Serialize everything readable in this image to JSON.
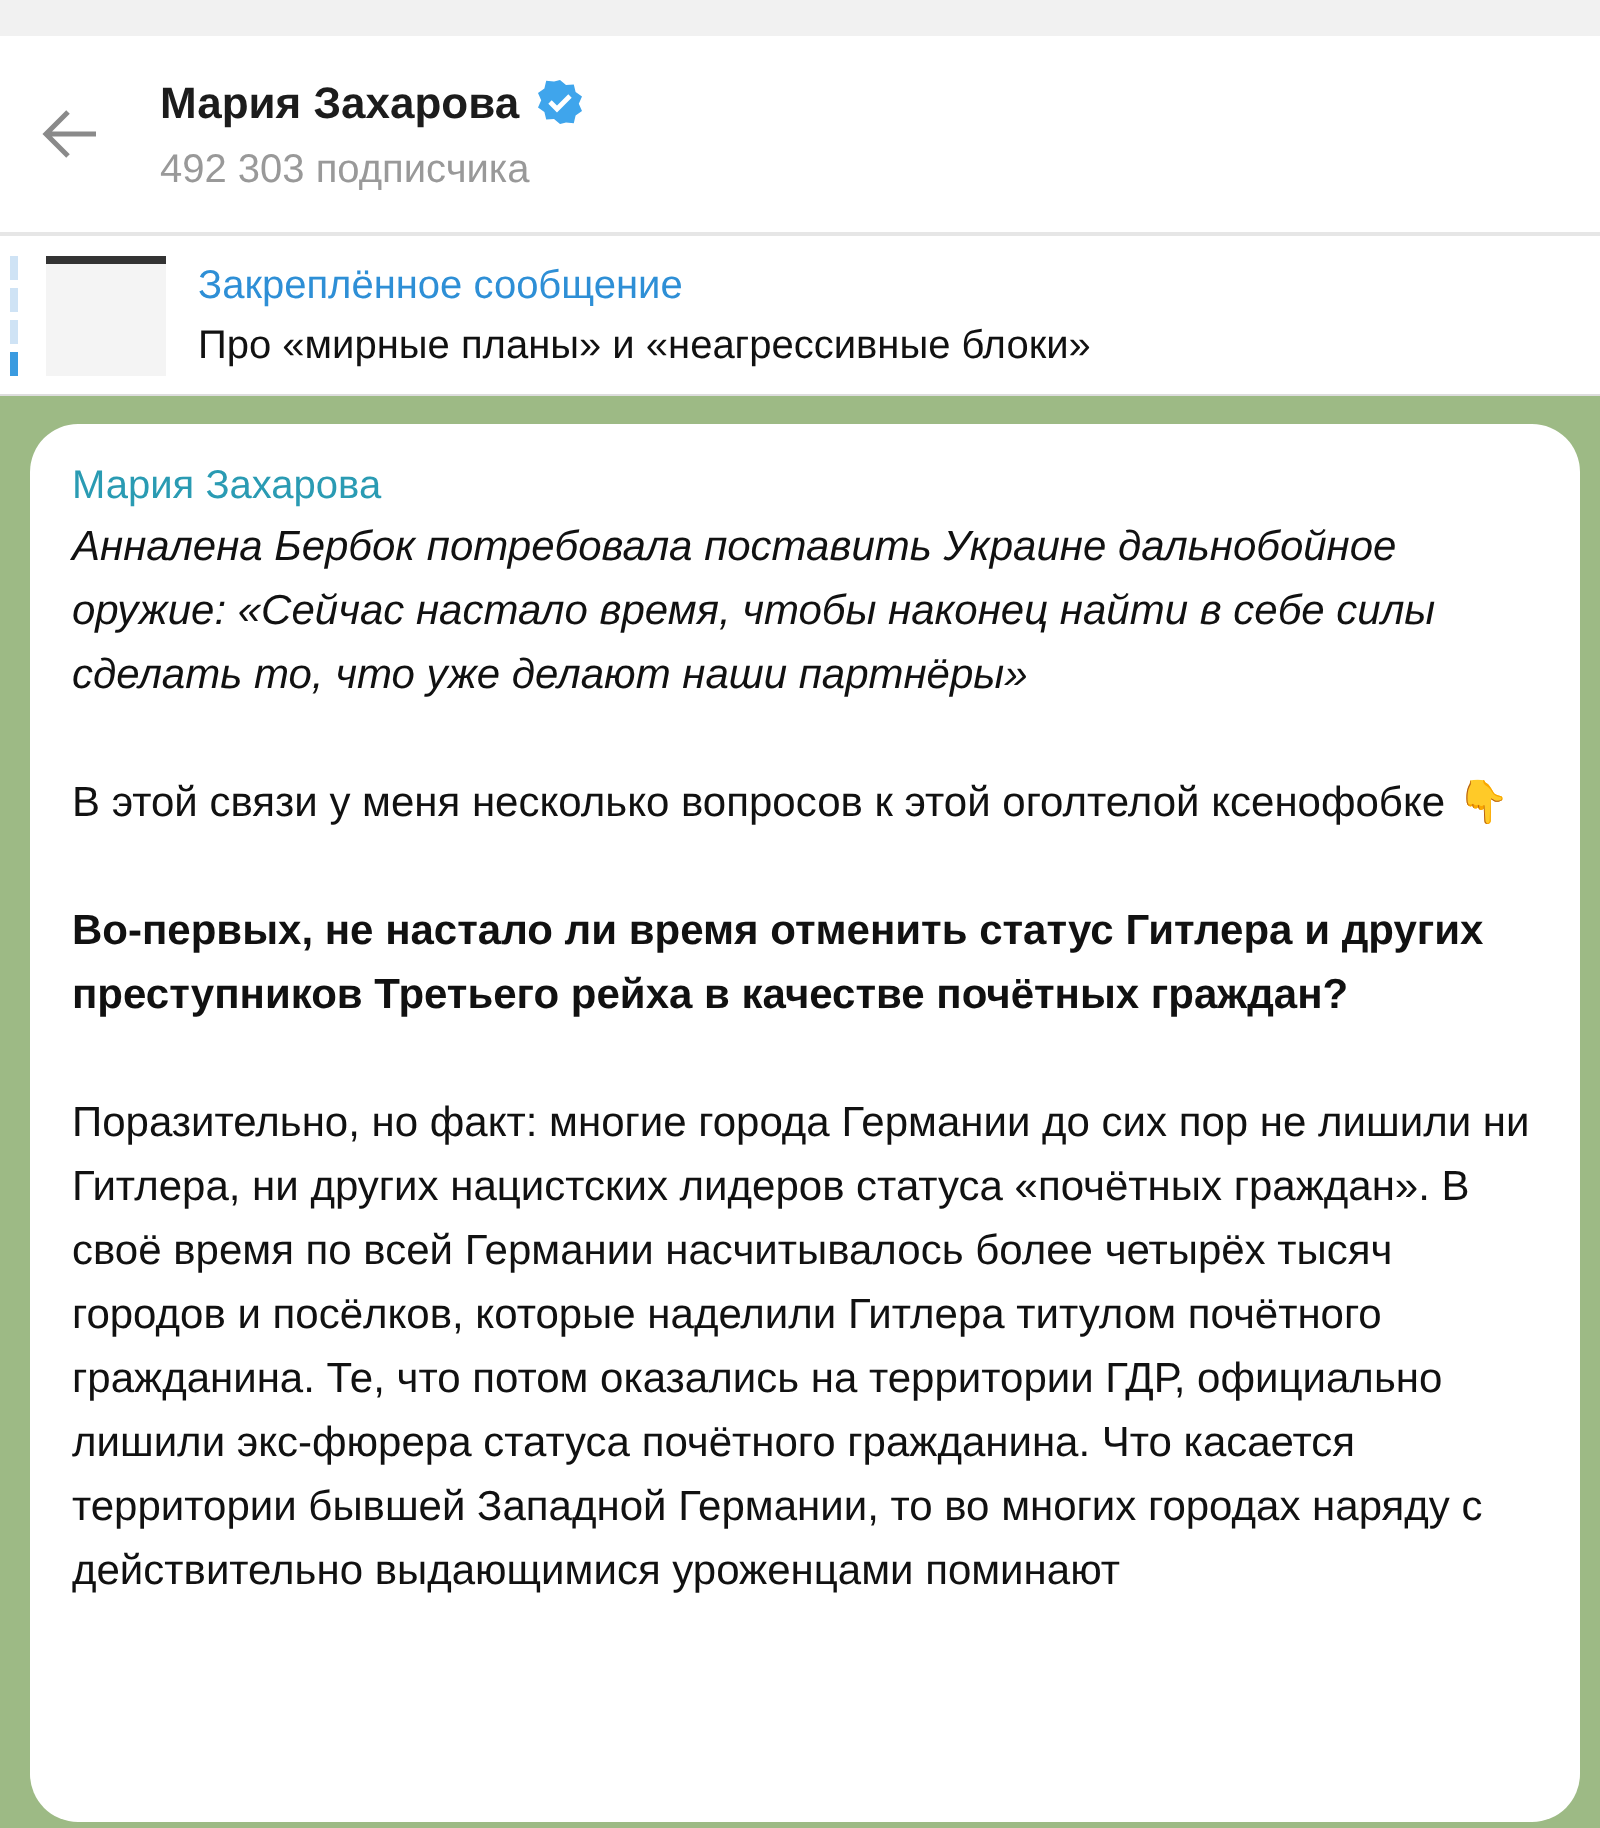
{
  "header": {
    "title": "Мария Захарова",
    "verified": true,
    "subtitle": "492 303 подписчика"
  },
  "pinned": {
    "label": "Закреплённое сообщение",
    "text": "Про «мирные планы» и «неагрессивные блоки»"
  },
  "message": {
    "author": "Мария Захарова",
    "paragraphs": [
      {
        "kind": "italic",
        "text": "Анналена Бербок потребовала поставить Украине дальнобойное оружие: «Сейчас настало время, чтобы наконец найти в себе силы сделать то, что уже делают наши партнёры»"
      },
      {
        "kind": "plain",
        "text": "В этой связи у меня несколько вопросов к этой оголтелой ксенофобке 👇"
      },
      {
        "kind": "bold",
        "text": "Во-первых, не настало ли время отменить статус Гитлера и других преступников Третьего рейха в качестве почётных граждан?"
      },
      {
        "kind": "plain",
        "text": "Поразительно, но факт: многие города Германии до сих пор не лишили ни Гитлера, ни других нацистских лидеров статуса «почётных граждан». В своё время по всей Германии насчитывалось более четырёх тысяч городов и посёлков, которые наделили Гитлера титулом почётного гражданина. Те, что потом оказались на территории ГДР, официально лишили экс-фюрера статуса почётного гражданина. Что касается территории бывшей Западной Германии, то во многих городах наряду с действительно выдающимися уроженцами поминают"
      }
    ]
  }
}
